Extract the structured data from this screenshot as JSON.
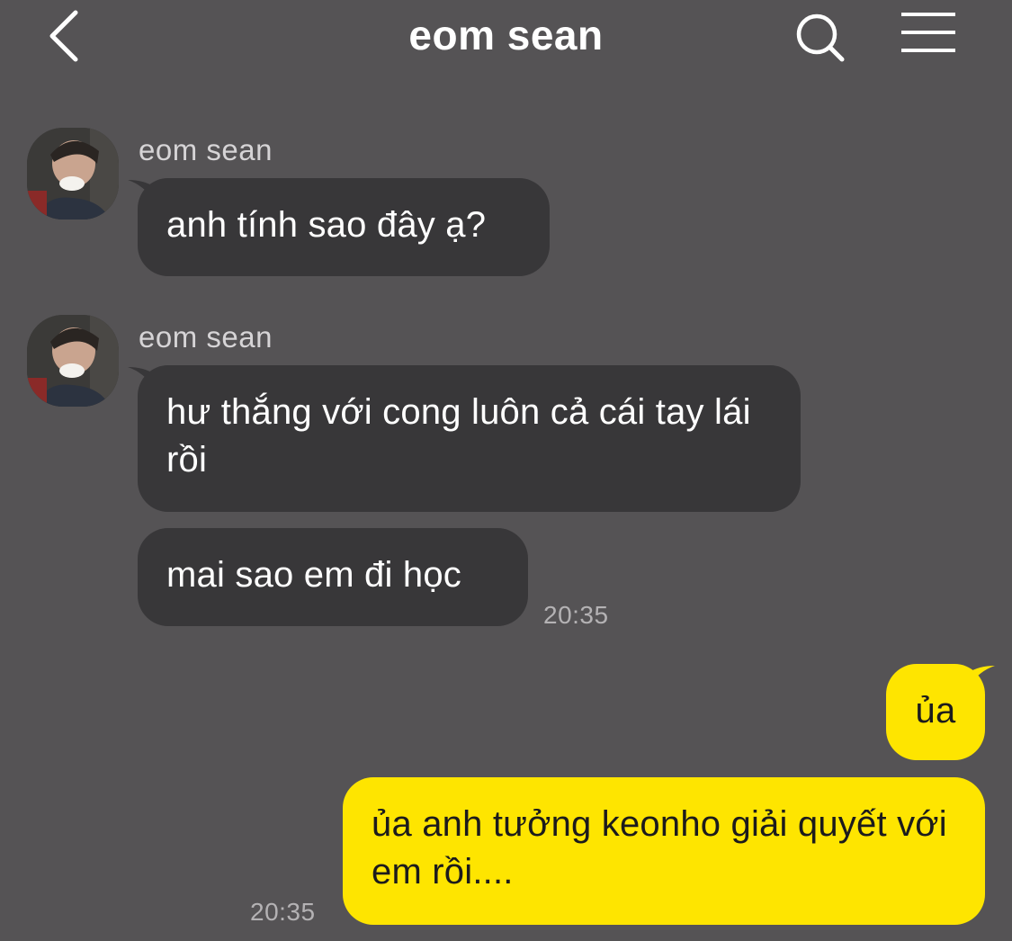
{
  "header": {
    "title": "eom sean",
    "back_icon": "chevron-left-icon",
    "search_icon": "search-icon",
    "menu_icon": "hamburger-menu-icon"
  },
  "colors": {
    "background": "#555355",
    "incoming_bubble": "#383739",
    "outgoing_bubble": "#fee500"
  },
  "messages": [
    {
      "sender": "eom sean",
      "text": "anh tính sao đây ạ?"
    },
    {
      "sender": "eom sean",
      "text": "hư thắng với cong luôn cả cái tay lái rồi"
    },
    {
      "text": "mai sao em đi học",
      "time": "20:35"
    },
    {
      "text": "ủa"
    },
    {
      "text": "ủa anh tưởng keonho giải quyết với em rồi....",
      "time": "20:35"
    }
  ]
}
